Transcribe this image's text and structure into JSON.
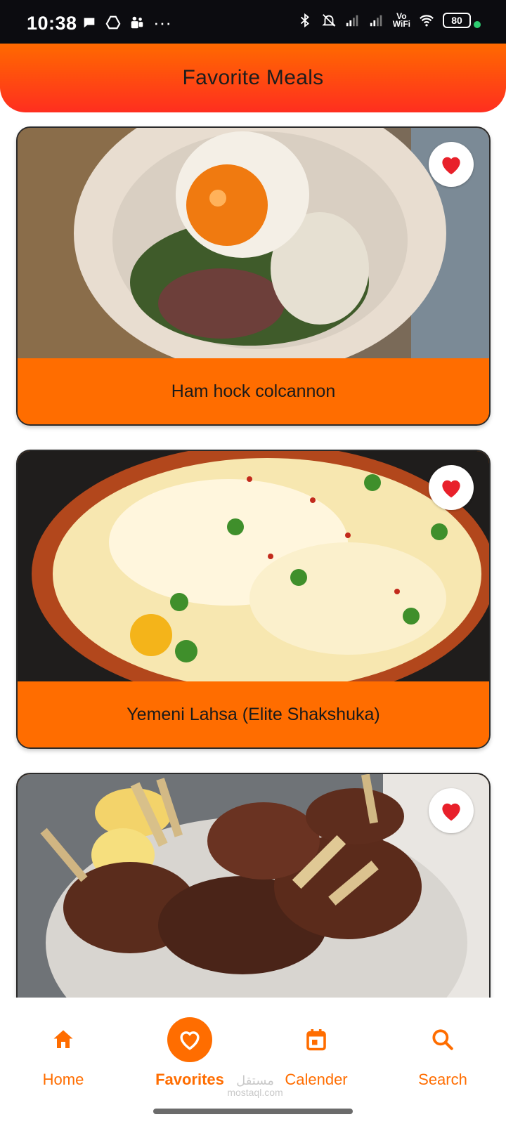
{
  "status_bar": {
    "time": "10:38",
    "vowifi_top": "Vo",
    "vowifi_bottom": "WiFi",
    "battery": "80",
    "dots": "···"
  },
  "header": {
    "title": "Favorite Meals"
  },
  "meals": [
    {
      "name": "Ham hock colcannon",
      "favorite": true
    },
    {
      "name": "Yemeni Lahsa (Elite Shakshuka)",
      "favorite": true
    },
    {
      "name": "",
      "favorite": true
    }
  ],
  "nav": {
    "items": [
      {
        "label": "Home",
        "icon": "home-icon",
        "active": false
      },
      {
        "label": "Favorites",
        "icon": "heart-outline-icon",
        "active": true
      },
      {
        "label": "Calender",
        "icon": "calendar-icon",
        "active": false
      },
      {
        "label": "Search",
        "icon": "search-icon",
        "active": false
      }
    ]
  },
  "watermark": {
    "text": "مستقل",
    "sub": "mostaql.com"
  },
  "colors": {
    "accent": "#ff6d00",
    "header_gradient_start": "#ff6a00",
    "header_gradient_end": "#ff2e1f",
    "heart": "#e8202a"
  }
}
